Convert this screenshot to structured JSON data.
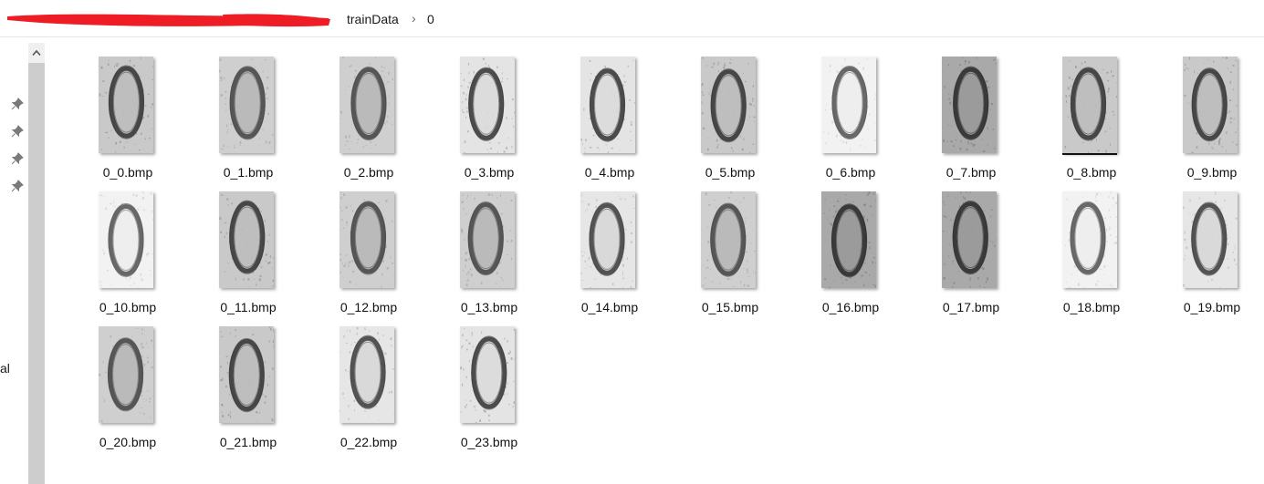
{
  "breadcrumb": {
    "items": [
      "trainData",
      "0"
    ],
    "separator": "›"
  },
  "nav": {
    "partial_label": "al",
    "pinned_count": 4
  },
  "files": [
    {
      "name": "0_0.bmp",
      "tone": "speckle"
    },
    {
      "name": "0_1.bmp",
      "tone": "streak"
    },
    {
      "name": "0_2.bmp",
      "tone": "streak"
    },
    {
      "name": "0_3.bmp",
      "tone": "light-speckle"
    },
    {
      "name": "0_4.bmp",
      "tone": "light-speckle"
    },
    {
      "name": "0_5.bmp",
      "tone": "speckle"
    },
    {
      "name": "0_6.bmp",
      "tone": "light"
    },
    {
      "name": "0_7.bmp",
      "tone": "dark-streak"
    },
    {
      "name": "0_8.bmp",
      "tone": "speckle"
    },
    {
      "name": "0_9.bmp",
      "tone": "speckle"
    },
    {
      "name": "0_10.bmp",
      "tone": "light"
    },
    {
      "name": "0_11.bmp",
      "tone": "speckle"
    },
    {
      "name": "0_12.bmp",
      "tone": "streak"
    },
    {
      "name": "0_13.bmp",
      "tone": "streak"
    },
    {
      "name": "0_14.bmp",
      "tone": "light-streak"
    },
    {
      "name": "0_15.bmp",
      "tone": "streak"
    },
    {
      "name": "0_16.bmp",
      "tone": "dark-streak"
    },
    {
      "name": "0_17.bmp",
      "tone": "dark-streak"
    },
    {
      "name": "0_18.bmp",
      "tone": "light"
    },
    {
      "name": "0_19.bmp",
      "tone": "light-streak"
    },
    {
      "name": "0_20.bmp",
      "tone": "streak"
    },
    {
      "name": "0_21.bmp",
      "tone": "speckle"
    },
    {
      "name": "0_22.bmp",
      "tone": "light-streak"
    },
    {
      "name": "0_23.bmp",
      "tone": "light-speckle"
    }
  ],
  "colors": {
    "redaction": "#ee1c24",
    "scroll_thumb": "#cdcdcd",
    "scroll_track_button": "#f0f0f0"
  }
}
